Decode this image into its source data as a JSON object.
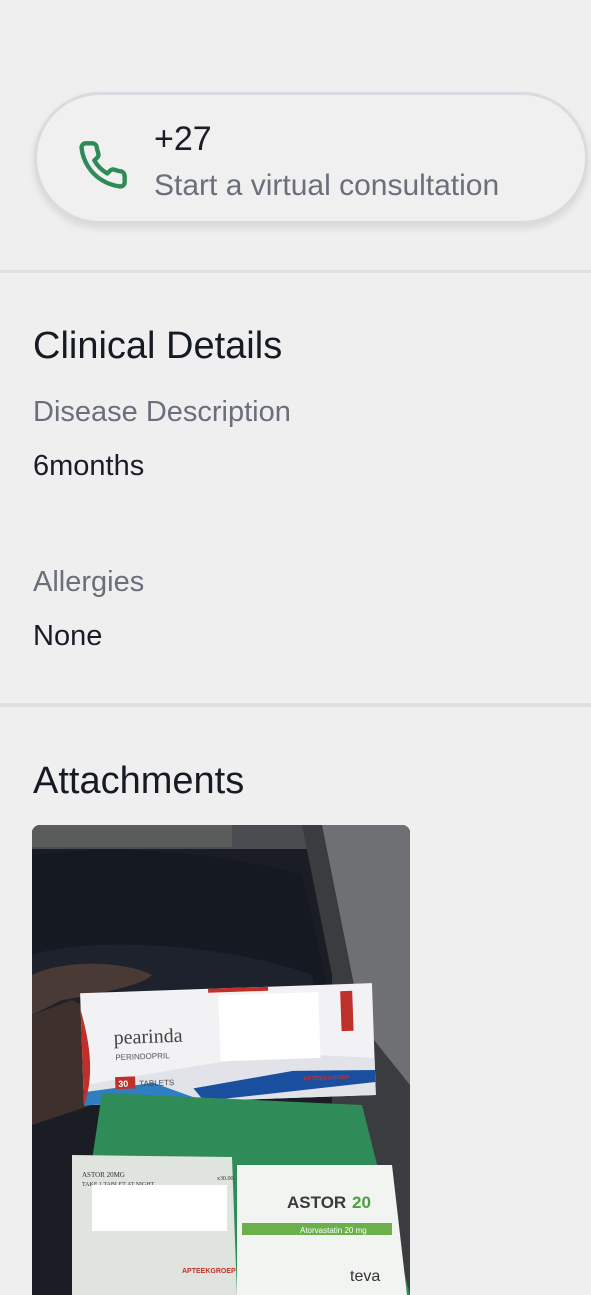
{
  "call": {
    "number": "+27",
    "cta": "Start a virtual consultation",
    "icon": "phone-icon",
    "accent": "#2e8b57"
  },
  "clinical": {
    "title": "Clinical Details",
    "disease_label": "Disease Description",
    "disease_value": "6months",
    "allergies_label": "Allergies",
    "allergies_value": "None"
  },
  "attachments": {
    "title": "Attachments",
    "box1": {
      "brand": "pearinda",
      "generic": "PERINDOPRIL",
      "count": "30",
      "tablets_label": "TABLETS",
      "stamp": "APTEEKGROEP"
    },
    "box2": {
      "brand": "ASTOR",
      "brand_strength": "20",
      "generic": "Atorvastatin 20 mg",
      "label_title": "ASTOR 20MG",
      "label_line": "TAKE 1 TABLET AT NIGHT",
      "price": "x30.00",
      "maker": "teva",
      "stamp": "APTEEKGROEP"
    }
  }
}
